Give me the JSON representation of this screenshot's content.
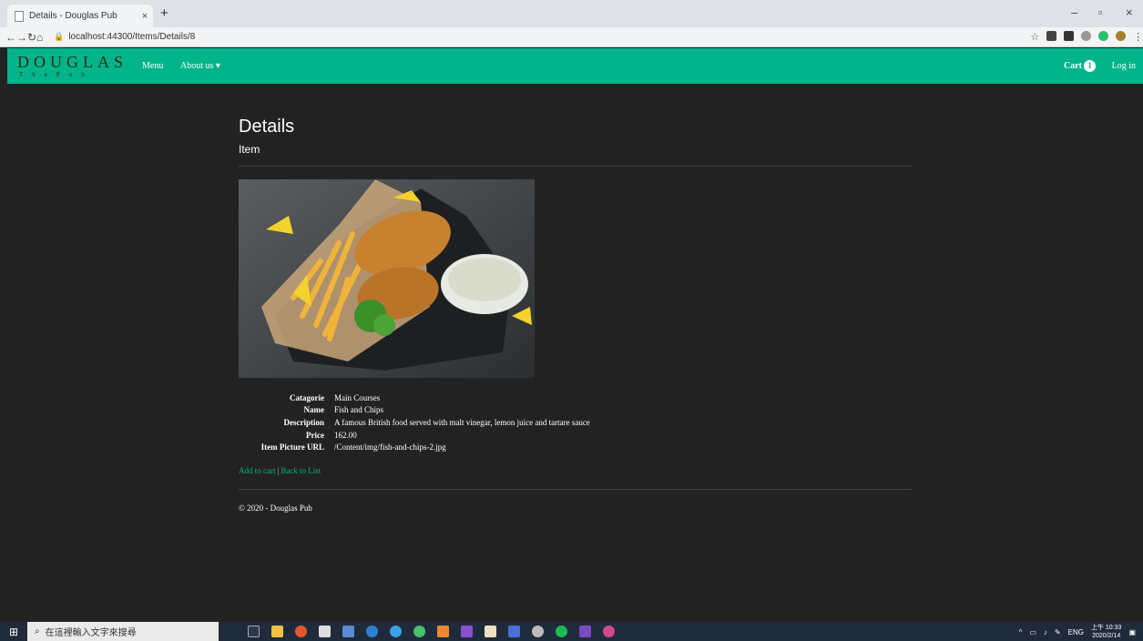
{
  "browser": {
    "tab_title": "Details - Douglas Pub",
    "tab_close": "×",
    "new_tab": "+",
    "url": "localhost:44300/Items/Details/8",
    "win_min": "–",
    "win_restore": "▫",
    "win_close": "×"
  },
  "nav": {
    "brand": "DOUGLAS",
    "brand_sub": "ThePub",
    "menu": "Menu",
    "about": "About us ▾",
    "cart_label": "Cart",
    "cart_count": "1",
    "login": "Log in",
    "bg_color": "#00b48a"
  },
  "page": {
    "title": "Details",
    "subtitle": "Item",
    "fields": [
      {
        "label": "Catagorie",
        "value": "Main Courses"
      },
      {
        "label": "Name",
        "value": "Fish and Chips"
      },
      {
        "label": "Description",
        "value": "A famous British food served with malt vinegar, lemon juice and tartare sauce"
      },
      {
        "label": "Price",
        "value": "162.00"
      },
      {
        "label": "Item Picture URL",
        "value": "/Content/img/fish-and-chips-2.jpg"
      }
    ],
    "add_to_cart": "Add to cart",
    "separator": "|",
    "back_to_list": "Back to List",
    "footer": "© 2020 - Douglas Pub"
  },
  "taskbar": {
    "search_placeholder": "在這裡輸入文字來搜尋",
    "lang": "ENG",
    "time": "上午 10:33",
    "date": "2020/2/14"
  }
}
